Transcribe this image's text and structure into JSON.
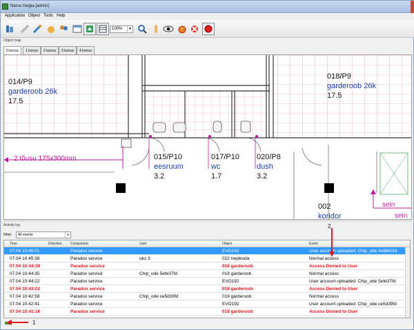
{
  "window": {
    "title": "Narva Haigla [admin]"
  },
  "menu": [
    "Application",
    "Object",
    "Tools",
    "Help"
  ],
  "toolbar": {
    "zoom_value": "100%",
    "icons": [
      "users-icon",
      "pencil-icon",
      "edit-icon",
      "hand-icon",
      "people-icon",
      "window-icon",
      "map-export-icon",
      "table-icon",
      "zoom-icon",
      "hand-pointer-icon",
      "eye-icon",
      "alarm-clock-icon",
      "remove-alarm-icon",
      "record-icon"
    ]
  },
  "object_map": {
    "section_title": "Object map",
    "tabs": [
      "0 korrus",
      "1 korrus",
      "2 korrus",
      "3 korrus",
      "4 korrus"
    ],
    "active_tab": 0,
    "labels": {
      "room_014": [
        "014/P9",
        "garderoob 26k",
        "17.5"
      ],
      "room_018": [
        "018/P9",
        "garderoob 26k",
        "17.5"
      ],
      "room_015": [
        "015/P10",
        "eesruum",
        "3.2"
      ],
      "room_017": [
        "017/P10",
        "wc",
        "1.7"
      ],
      "room_020": [
        "020/P8",
        "dush",
        "3.2"
      ],
      "room_002": [
        "002",
        "koridor"
      ],
      "stairs": "2 tõusu 175x300mm",
      "sein": [
        "sein",
        "sein"
      ]
    }
  },
  "activity_log": {
    "section_title": "Activity log",
    "filter_label": "Filter:",
    "filter_value": "All events",
    "columns": [
      "Time",
      "Direction",
      "Component",
      "User",
      "Object",
      "Event"
    ],
    "rows": [
      {
        "time": "07.04 10:46:01",
        "direction": "",
        "component": "Paradox service",
        "user": "",
        "object": "EVO192",
        "event": "User account uploaded: Chip_ode 4e6841fd",
        "state": "selected"
      },
      {
        "time": "07.04 10:45:38",
        "direction": "",
        "component": "Paradox service",
        "user": "uks 3",
        "object": "022 trepikoda",
        "event": "Normal access",
        "state": "normal"
      },
      {
        "time": "07.04 10:44:39",
        "direction": "",
        "component": "Paradox service",
        "user": "",
        "object": "018 garderoob",
        "event": "Access Denied to User",
        "state": "denied"
      },
      {
        "time": "07.04 10:44:35",
        "direction": "",
        "component": "Paradox service",
        "user": "Chip_ode 5efe37fd",
        "object": "018 garderoob",
        "event": "Normal access",
        "state": "normal"
      },
      {
        "time": "07.04 10:44:22",
        "direction": "",
        "component": "Paradox service",
        "user": "",
        "object": "EVO192",
        "event": "User account uploaded: Chip_ode 5efe37fd",
        "state": "normal"
      },
      {
        "time": "07.04 10:43:02",
        "direction": "",
        "component": "Paradox service",
        "user": "",
        "object": "018 garderoob",
        "event": "Access Denied to User",
        "state": "denied"
      },
      {
        "time": "07.04 10:42:58",
        "direction": "",
        "component": "Paradox service",
        "user": "Chip_ode ce5d39fd",
        "object": "018 garderoob",
        "event": "Normal access",
        "state": "normal"
      },
      {
        "time": "07.04 10:42:41",
        "direction": "",
        "component": "Paradox service",
        "user": "",
        "object": "EVO192",
        "event": "User account uploaded: Chip_ode ce5d39fd",
        "state": "normal"
      },
      {
        "time": "07.04 10:41:16",
        "direction": "",
        "component": "Paradox service",
        "user": "",
        "object": "018 garderoob",
        "event": "Access Denied to User",
        "state": "denied"
      }
    ]
  },
  "annotations": {
    "marker_1": "1",
    "marker_2": "2"
  },
  "colors": {
    "selected_row": "#3399ff",
    "denied_text": "#e0141b",
    "annotation_arrow": "#e0141b",
    "blue_label": "#1a3fa8",
    "magenta_label": "#c0169f",
    "status_ok": "#4bc04b"
  }
}
